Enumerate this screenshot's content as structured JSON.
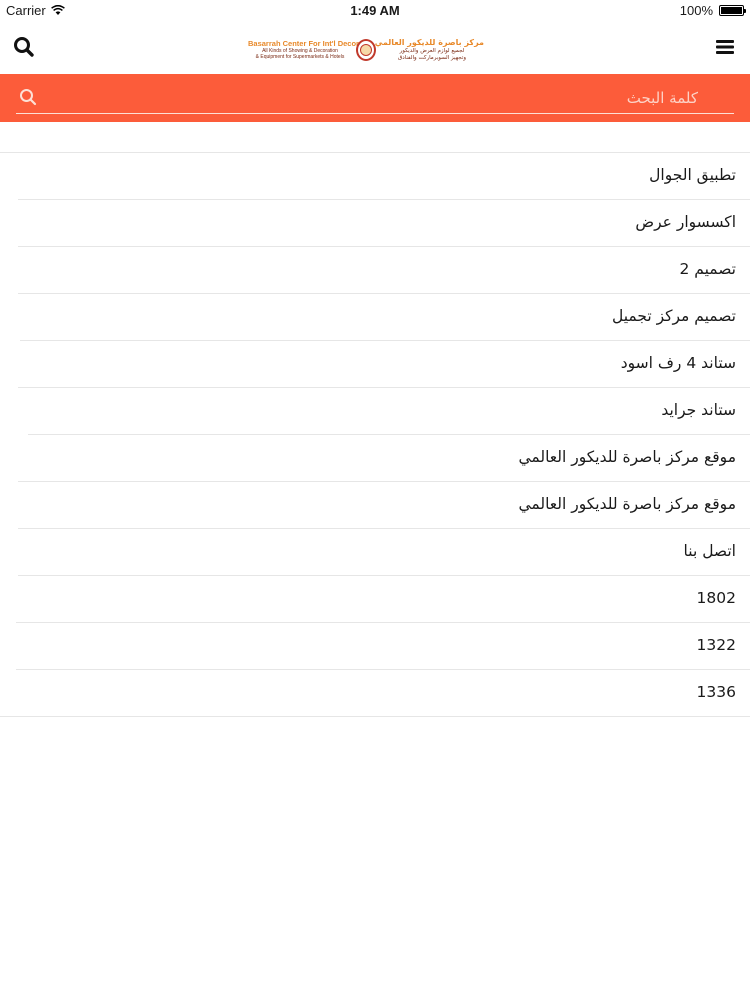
{
  "status_bar": {
    "carrier": "Carrier",
    "time": "1:49 AM",
    "battery": "100%",
    "battery_level": 1.0
  },
  "header": {
    "logo": {
      "en_line1": "Basarrah Center For Int'l Decor",
      "en_line2": "All Kinds of Showing & Decoration",
      "en_line3": "& Equipment for Supermarkets & Hotels",
      "ar_line1": "مركز باصرة للديكور العالمي",
      "ar_line2": "لجميع لوازم العرض والديكور",
      "ar_line3": "وتجهيز السوبرماركت والفنادق"
    },
    "search_icon": "search-icon",
    "menu_icon": "hamburger-menu-icon"
  },
  "search": {
    "placeholder": "كلمة البحث",
    "value": ""
  },
  "list": {
    "items": [
      {
        "label": "تطبيق الجوال"
      },
      {
        "label": "اكسسوار عرض"
      },
      {
        "label": "تصميم 2"
      },
      {
        "label": "تصميم مركز تجميل"
      },
      {
        "label": "ستاند 4 رف اسود"
      },
      {
        "label": "ستاند جرايد"
      },
      {
        "label": "موقع مركز باصرة للديكور العالمي"
      },
      {
        "label": "موقع مركز باصرة للديكور العالمي"
      },
      {
        "label": "اتصل بنا"
      },
      {
        "label": "1802"
      },
      {
        "label": "1322"
      },
      {
        "label": "1336"
      }
    ]
  },
  "colors": {
    "accent": "#fc5c3a",
    "separator": "#e6e6e6",
    "logo_orange": "#e8892a",
    "logo_brown": "#7a2a14"
  }
}
